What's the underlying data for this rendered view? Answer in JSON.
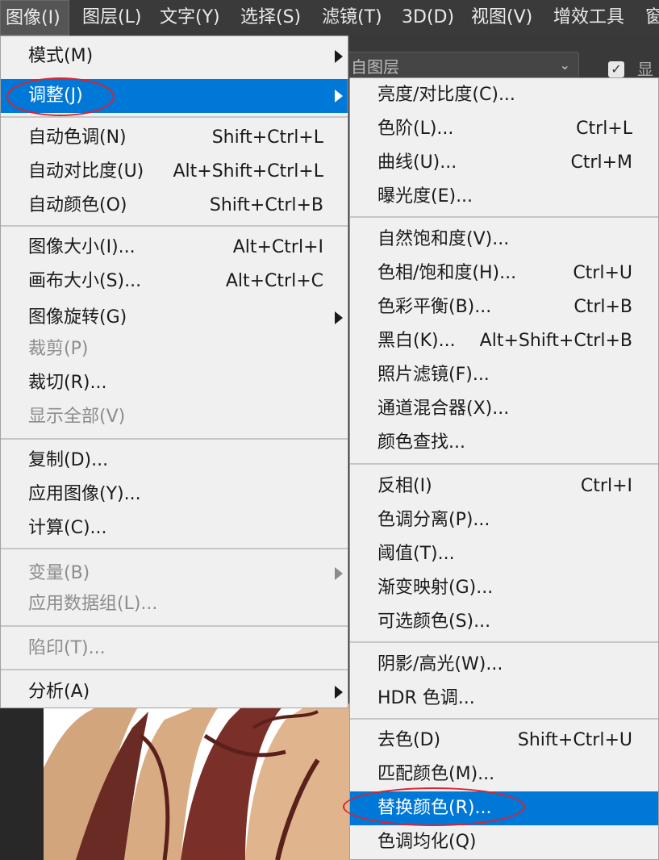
{
  "menubar": {
    "items": [
      "图像(I)",
      "图层(L)",
      "文字(Y)",
      "选择(S)",
      "滤镜(T)",
      "3D(D)",
      "视图(V)",
      "增效工具",
      "窗"
    ]
  },
  "options_bar": {
    "layer_select_value": "自图层",
    "show_checkbox_checked": true,
    "show_label": "显"
  },
  "image_menu": {
    "items": [
      {
        "label": "模式(M)",
        "submenu": true
      },
      {
        "label": "调整(J)",
        "submenu": true,
        "highlighted": true
      },
      {
        "label": "自动色调(N)",
        "shortcut": "Shift+Ctrl+L"
      },
      {
        "label": "自动对比度(U)",
        "shortcut": "Alt+Shift+Ctrl+L"
      },
      {
        "label": "自动颜色(O)",
        "shortcut": "Shift+Ctrl+B"
      },
      {
        "label": "图像大小(I)...",
        "shortcut": "Alt+Ctrl+I"
      },
      {
        "label": "画布大小(S)...",
        "shortcut": "Alt+Ctrl+C"
      },
      {
        "label": "图像旋转(G)",
        "submenu": true
      },
      {
        "label": "裁剪(P)",
        "disabled": true
      },
      {
        "label": "裁切(R)..."
      },
      {
        "label": "显示全部(V)",
        "disabled": true
      },
      {
        "label": "复制(D)..."
      },
      {
        "label": "应用图像(Y)..."
      },
      {
        "label": "计算(C)..."
      },
      {
        "label": "变量(B)",
        "submenu": true,
        "disabled": true
      },
      {
        "label": "应用数据组(L)...",
        "disabled": true
      },
      {
        "label": "陷印(T)...",
        "disabled": true
      },
      {
        "label": "分析(A)",
        "submenu": true
      }
    ]
  },
  "adjust_menu": {
    "items": [
      {
        "label": "亮度/对比度(C)..."
      },
      {
        "label": "色阶(L)...",
        "shortcut": "Ctrl+L"
      },
      {
        "label": "曲线(U)...",
        "shortcut": "Ctrl+M"
      },
      {
        "label": "曝光度(E)..."
      },
      {
        "label": "自然饱和度(V)..."
      },
      {
        "label": "色相/饱和度(H)...",
        "shortcut": "Ctrl+U"
      },
      {
        "label": "色彩平衡(B)...",
        "shortcut": "Ctrl+B"
      },
      {
        "label": "黑白(K)...",
        "shortcut": "Alt+Shift+Ctrl+B"
      },
      {
        "label": "照片滤镜(F)..."
      },
      {
        "label": "通道混合器(X)..."
      },
      {
        "label": "颜色查找..."
      },
      {
        "label": "反相(I)",
        "shortcut": "Ctrl+I"
      },
      {
        "label": "色调分离(P)..."
      },
      {
        "label": "阈值(T)..."
      },
      {
        "label": "渐变映射(G)..."
      },
      {
        "label": "可选颜色(S)..."
      },
      {
        "label": "阴影/高光(W)..."
      },
      {
        "label": "HDR 色调..."
      },
      {
        "label": "去色(D)",
        "shortcut": "Shift+Ctrl+U"
      },
      {
        "label": "匹配颜色(M)..."
      },
      {
        "label": "替换颜色(R)...",
        "highlighted": true
      },
      {
        "label": "色调均化(Q)"
      }
    ]
  },
  "colors": {
    "highlight": "#0078d7",
    "annotation": "#e0202a",
    "menu_bg": "#f0f0f0",
    "disabled_text": "#8c8c8c"
  }
}
